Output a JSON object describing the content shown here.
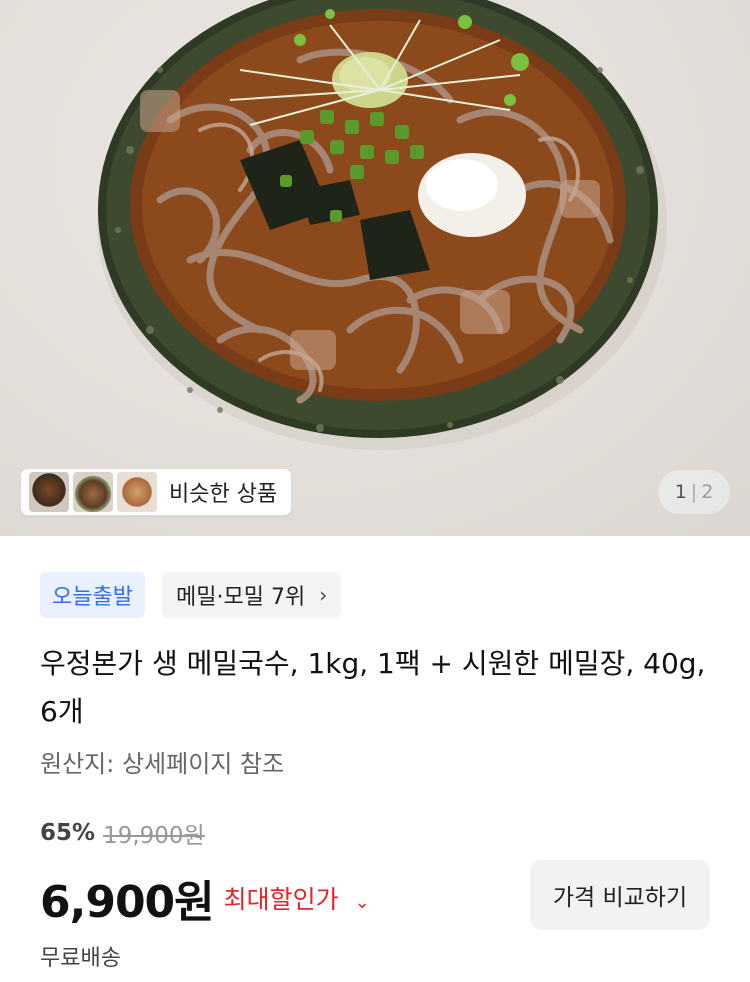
{
  "gallery": {
    "similar_products_label": "비슷한 상품",
    "current_page": "1",
    "total_pages": "2",
    "thumbnails": [
      "similar-product-thumb-1",
      "similar-product-thumb-2",
      "similar-product-thumb-3"
    ]
  },
  "badges": {
    "delivery": "오늘출발",
    "category_rank": "메밀·모밀 7위"
  },
  "product": {
    "title": "우정본가 생 메밀국수, 1kg, 1팩 + 시원한 메밀장, 40g, 6개",
    "origin": "원산지: 상세페이지 참조"
  },
  "pricing": {
    "discount_rate": "65%",
    "original_price": "19,900원",
    "sale_price": "6,900원",
    "max_discount_label": "최대할인가",
    "compare_button": "가격 비교하기",
    "shipping": "무료배송"
  },
  "colors": {
    "accent_blue": "#346aff",
    "discount_red": "#e52528",
    "badge_bg": "#e8f1fd"
  },
  "icons": {
    "rank_chevron": "chevron-right-icon",
    "max_discount_chevron": "chevron-down-icon"
  }
}
